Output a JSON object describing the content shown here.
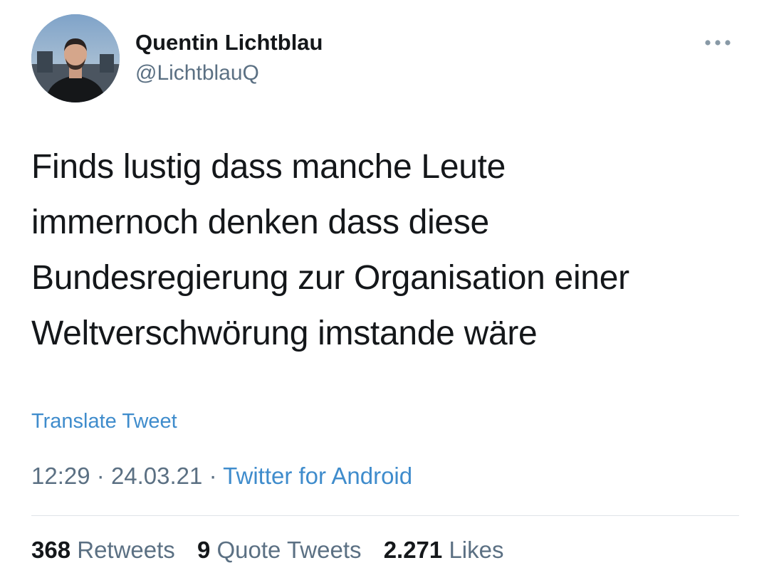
{
  "author": {
    "name": "Quentin Lichtblau",
    "handle": "@LichtblauQ",
    "avatar_icon": "profile-photo"
  },
  "more_icon": "more-dots-icon",
  "tweet": {
    "text": "Finds lustig dass manche Leute\nimmernoch denken dass diese\nBundesregierung zur Organisation einer\nWeltverschwörung imstande wäre",
    "translate_label": "Translate Tweet",
    "time": "12:29",
    "separator": "·",
    "date": "24.03.21",
    "source": "Twitter for Android"
  },
  "stats": {
    "retweets_count": "368",
    "retweets_label": "Retweets",
    "quotes_count": "9",
    "quotes_label": "Quote Tweets",
    "likes_count": "2.271",
    "likes_label": "Likes"
  },
  "colors": {
    "link": "#3f8ccc",
    "secondary_text": "#5b7083",
    "primary_text": "#14171a",
    "divider": "#dfe4e8"
  }
}
